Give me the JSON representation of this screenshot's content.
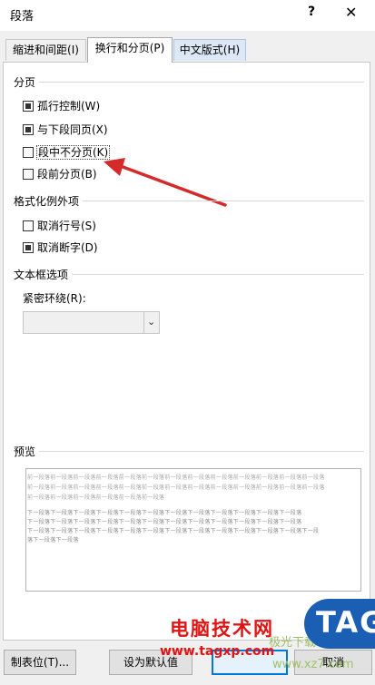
{
  "window": {
    "title": "段落",
    "help_label": "?",
    "close_label": "✕"
  },
  "tabs": [
    {
      "label": "缩进和间距(I)",
      "active": false
    },
    {
      "label": "换行和分页(P)",
      "active": true
    },
    {
      "label": "中文版式(H)",
      "active": false
    }
  ],
  "pagination": {
    "section_label": "分页",
    "options": [
      {
        "label": "孤行控制(W)",
        "checked": true
      },
      {
        "label": "与下段同页(X)",
        "checked": true
      },
      {
        "label": "段中不分页(K)",
        "checked": false
      },
      {
        "label": "段前分页(B)",
        "checked": false
      }
    ]
  },
  "formatting_exceptions": {
    "section_label": "格式化例外项",
    "options": [
      {
        "label": "取消行号(S)",
        "checked": false
      },
      {
        "label": "取消断字(D)",
        "checked": true
      }
    ]
  },
  "textbox": {
    "section_label": "文本框选项",
    "wrap_label": "紧密环绕(R):",
    "wrap_value": ""
  },
  "preview": {
    "section_label": "预览",
    "lines": [
      "前一段落前一段落前一段落前一段落前一段落前一段落前一段落前一段落前一段落前一段落前一段落前一段落前一段落",
      "前一段落前一段落前一段落前一段落前一段落前一段落前一段落前一段落前一段落前一段落前一段落前一段落前一段落",
      "前一段落前一段落前一段落前一段落前一段落前一段落",
      "下一段落下一段落下一段落下一段落下一段落下一段落下一段落下一段落下一段落下一段落下一段落下一段落",
      "下一段落下一段落下一段落下一段落下一段落下一段落下一段落下一段落下一段落下一段落下一段落下一段落",
      "下一段落下一段落下一段落下一段落下一段落下一段落下一段落下一段落下一段落下一段落下一段落下一段落下一段",
      "落下一段落下一段落"
    ]
  },
  "buttons": {
    "tabs_label": "制表位(T)...",
    "default_label": "设为默认值",
    "cancel_label": "取消"
  },
  "watermark": {
    "site_name": "电脑技术网",
    "site_url": "www.tagxp.com",
    "logo": "TAG",
    "faint_text": "极光下载站",
    "faint_url": "www.xz7.com"
  },
  "colors": {
    "accent": "#0078d7",
    "annotation_arrow": "#d42a2a",
    "watermark_red": "#e11414",
    "logo_blue": "#1a5fb4"
  }
}
